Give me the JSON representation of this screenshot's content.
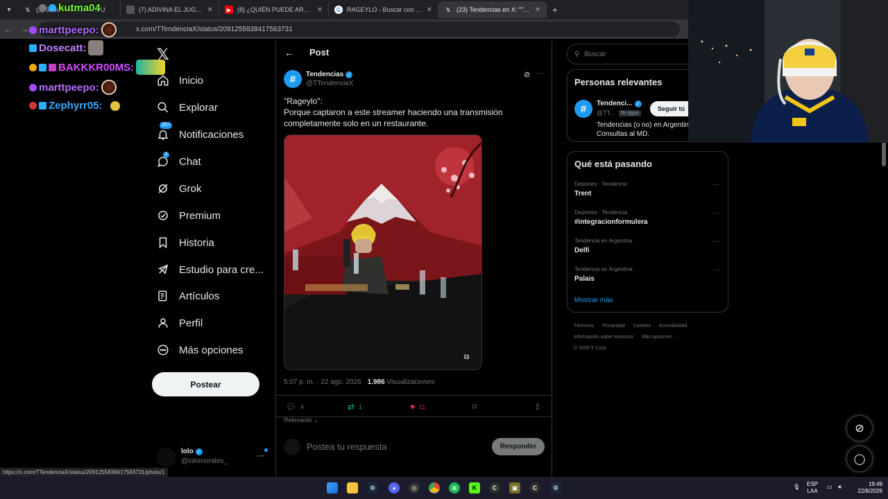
{
  "browser": {
    "tabs": [
      {
        "title": "(3) Subo... kutma04...CU",
        "favicon": "x",
        "active": false
      },
      {
        "title": "(7) ADIVINA EL JUGADOR EN 3",
        "favicon": "img",
        "active": false
      },
      {
        "title": "(8) ¿QUIÉN PUEDE ARMAR EL M",
        "favicon": "youtube",
        "active": false
      },
      {
        "title": "RAGEYLO - Buscar con Google",
        "favicon": "google",
        "active": false
      },
      {
        "title": "(23) Tendencias en X: \"\"Rageylo",
        "favicon": "x",
        "active": true
      }
    ],
    "url": "x.com/TTendenciaX/status/2091255838417563731",
    "status_url": "https://x.com/TTendenciaX/status/2091255838417563731/photo/1"
  },
  "chat_overlay": [
    {
      "user": "kutma04",
      "color": "#7cff3a"
    },
    {
      "user": "marttpeepo:",
      "color": "#b46cff"
    },
    {
      "user": "Dosecatt:",
      "color": "#c084ff"
    },
    {
      "user": "BAKKKR00MS:",
      "color": "#d44cff"
    },
    {
      "user": "marttpeepo:",
      "color": "#b46cff"
    },
    {
      "user": "Zephyrr05:",
      "color": "#3aa8ff"
    }
  ],
  "sidebar": {
    "items": [
      {
        "label": "Inicio",
        "icon": "home-icon"
      },
      {
        "label": "Explorar",
        "icon": "search-icon"
      },
      {
        "label": "Notificaciones",
        "icon": "bell-icon",
        "badge": "20+"
      },
      {
        "label": "Chat",
        "icon": "chat-icon",
        "badge": "3"
      },
      {
        "label": "Grok",
        "icon": "grok-icon"
      },
      {
        "label": "Premium",
        "icon": "premium-icon"
      },
      {
        "label": "Historia",
        "icon": "bookmark-icon"
      },
      {
        "label": "Estudio para cre...",
        "icon": "rocket-icon"
      },
      {
        "label": "Artículos",
        "icon": "articles-icon"
      },
      {
        "label": "Perfil",
        "icon": "person-icon"
      },
      {
        "label": "Más opciones",
        "icon": "more-circle-icon"
      }
    ],
    "post_button": "Postear",
    "account": {
      "name": "lolo",
      "handle": "@lolomorales_"
    }
  },
  "post": {
    "header": "Post",
    "author_name": "Tendencias",
    "author_handle": "@TTendenciaX",
    "text_line1": "\"Rageylo\":",
    "text_line2": "Porque captaron a este streamer haciendo una transmisión",
    "text_line3": "completamente solo en un restaurante.",
    "time": "5:07 p. m. · 22 ago. 2026 · ",
    "views": "1.986",
    "views_label": " Visualizaciones",
    "replies": "4",
    "reposts": "1",
    "likes": "21",
    "relevant_label": "Relevante",
    "reply_placeholder": "Postea tu respuesta",
    "reply_button": "Responder"
  },
  "right": {
    "search_placeholder": "Buscar",
    "relevant_title": "Personas relevantes",
    "relevant_person": {
      "name": "Tendenci...",
      "handle": "@TT...",
      "follows_you": "Te sigue",
      "follow_button": "Seguir tú",
      "bio": "Tendencias (o no) en Argentin Parodia. Consultas al MD."
    },
    "trends_title": "Qué está pasando",
    "trends": [
      {
        "category": "Deportes · Tendencia",
        "name": "Trent"
      },
      {
        "category": "Deportes · Tendencia",
        "name": "#integracionformulera"
      },
      {
        "category": "Tendencia en Argentina",
        "name": "Delfi"
      },
      {
        "category": "Tendencia en Argentina",
        "name": "Palais"
      }
    ],
    "show_more": "Mostrar más",
    "footer": {
      "terms": "Términos",
      "privacy": "Privacidad",
      "cookies": "Cookies",
      "accessibility": "Accesibilidad",
      "ads": "Información sobre anuncios",
      "more": "Más opciones ···",
      "copyright": "© 2026 X Corp."
    }
  },
  "taskbar": {
    "lang_top": "ESP",
    "lang_bottom": "LAA",
    "time": "19:49",
    "date": "22/8/2026"
  },
  "colors": {
    "accent": "#1d9bf0",
    "like": "#f91880",
    "repost": "#00ba7c",
    "background": "#000000"
  }
}
